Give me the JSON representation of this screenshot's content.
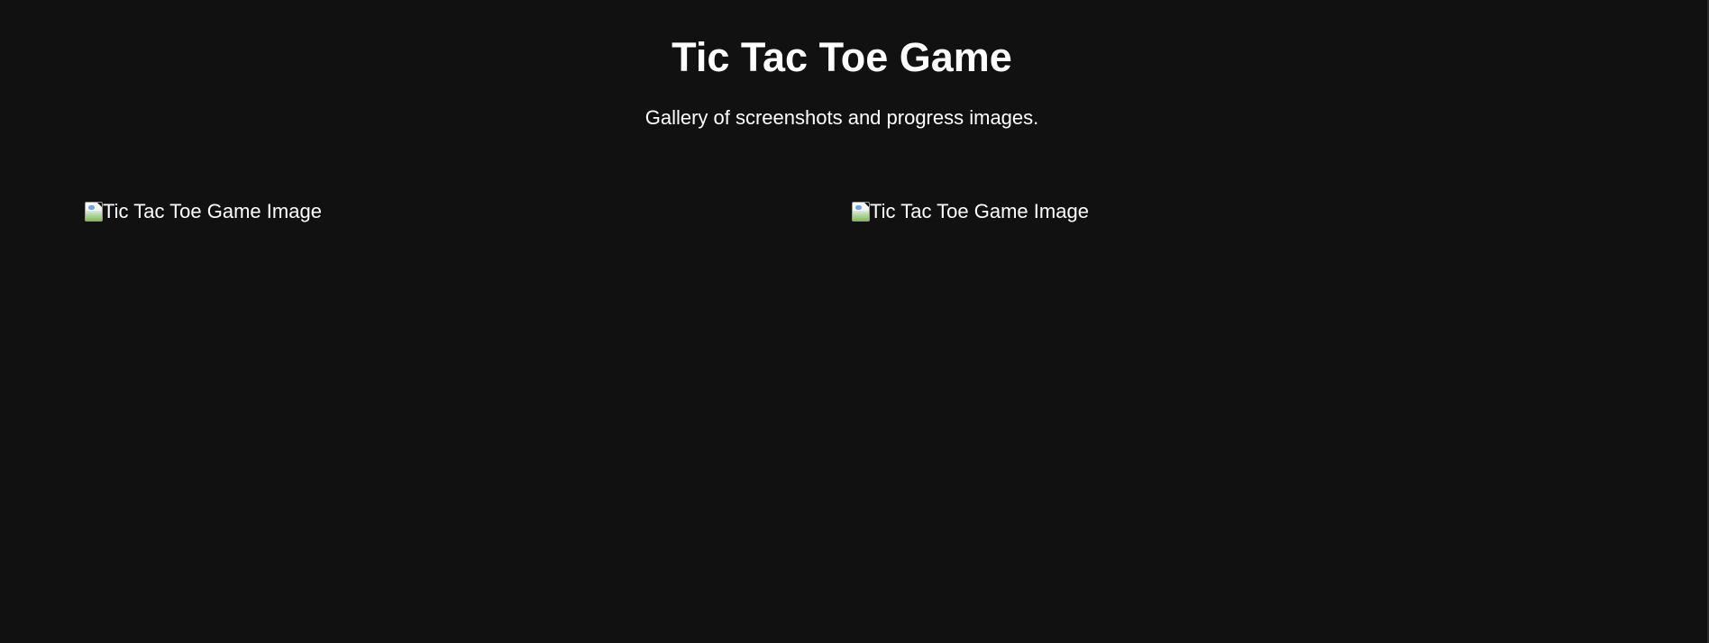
{
  "page": {
    "title": "Tic Tac Toe Game",
    "subtitle": "Gallery of screenshots and progress images."
  },
  "gallery": {
    "items": [
      {
        "alt_text": "Tic Tac Toe Game Image",
        "icon": "broken-image-icon"
      },
      {
        "alt_text": "Tic Tac Toe Game Image",
        "icon": "broken-image-icon"
      }
    ]
  },
  "colors": {
    "background": "#111111",
    "text": "#ffffff"
  }
}
